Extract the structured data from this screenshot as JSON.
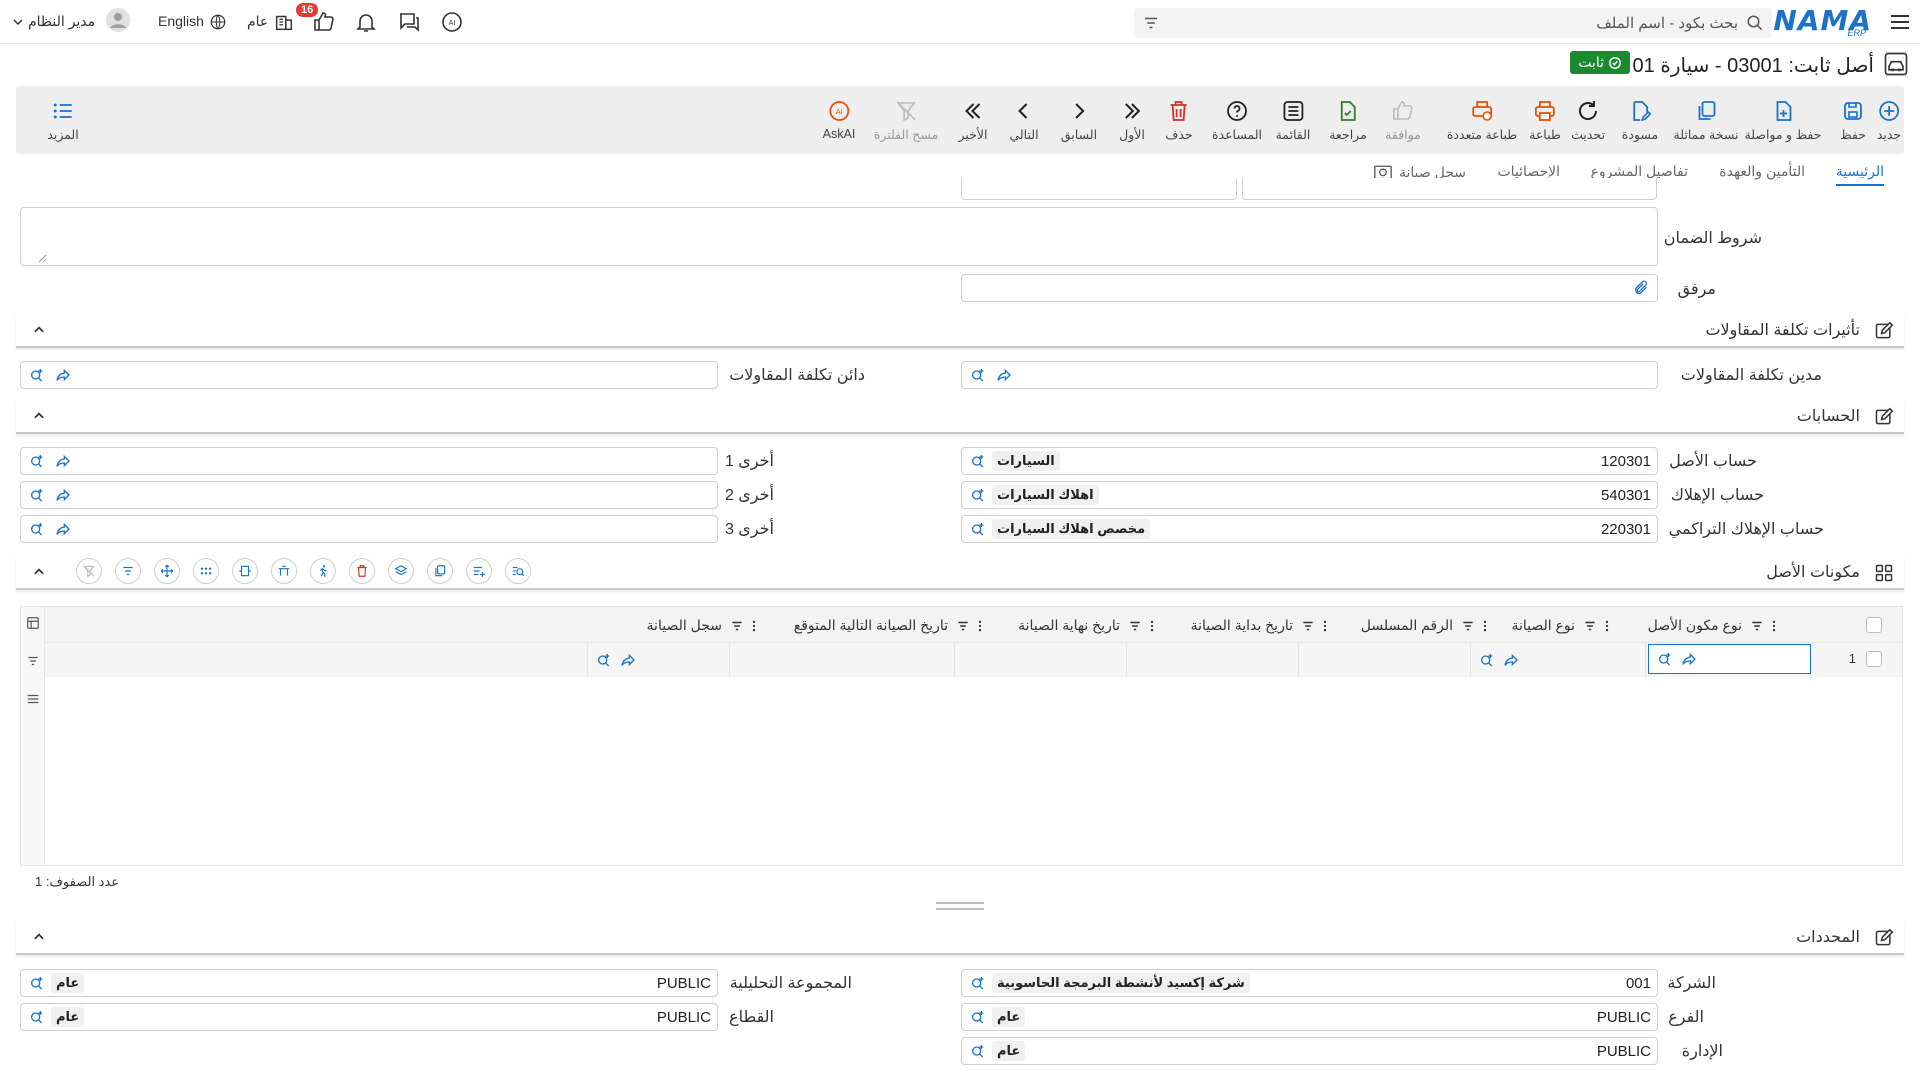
{
  "topbar": {
    "logo_text": "NAMA",
    "logo_sub": "ERP",
    "search_placeholder": "بحث بكود - اسم الملف",
    "notification_count": "16",
    "company": "عام",
    "language": "English",
    "user": "مدير النظام"
  },
  "title": {
    "text": "أصل ثابت: 03001 - سيارة 01",
    "status": "ثابت"
  },
  "toolbar": {
    "new": "جديد",
    "save": "حفظ",
    "save_continue": "حفظ و مواصلة",
    "duplicate": "نسخة مماثلة",
    "draft": "مسودة",
    "refresh": "تحديث",
    "print": "طباعة",
    "multi_print": "طباعة متعددة",
    "approve": "موافقة",
    "review": "مراجعة",
    "list": "القائمة",
    "help": "المساعدة",
    "delete": "حذف",
    "first": "الأول",
    "previous": "السابق",
    "next": "التالي",
    "last": "الأخير",
    "clear_filter": "مسح الفلترة",
    "askai": "AskAI",
    "more": "المزيد"
  },
  "tabs": [
    "الرئيسية",
    "التأمين والعهدة",
    "تفاصيل المشروع",
    "الإحصائيات",
    "سجل صيانة"
  ],
  "form": {
    "warranty_terms": "شروط الضمان",
    "attachment": "مرفق",
    "contract_section": "تأثيرات تكلفة المقاولات",
    "contract_debit": "مدين تكلفة المقاولات",
    "contract_credit": "دائن تكلفة المقاولات",
    "accounts_section": "الحسابات",
    "asset_account": "حساب الأصل",
    "asset_account_code": "120301",
    "asset_account_name": "السيارات",
    "depr_account": "حساب الإهلاك",
    "depr_account_code": "540301",
    "depr_account_name": "اهلاك السيارات",
    "accum_depr_account": "حساب الإهلاك التراكمي",
    "accum_depr_account_code": "220301",
    "accum_depr_account_name": "مخصص اهلاك السيارات",
    "other1": "أخرى 1",
    "other2": "أخرى 2",
    "other3": "أخرى 3",
    "components_section": "مكونات الأصل",
    "dimensions_section": "المحددات",
    "company": "الشركة",
    "company_code": "001",
    "company_name": "شركة إكسيد لأنشطة البرمجة الحاسوبية",
    "branch": "الفرع",
    "branch_code": "PUBLIC",
    "branch_name": "عام",
    "department": "الإدارة",
    "department_code": "PUBLIC",
    "department_name": "عام",
    "analytic_group": "المجموعة التحليلية",
    "analytic_group_code": "PUBLIC",
    "analytic_group_name": "عام",
    "sector": "القطاع",
    "sector_code": "PUBLIC",
    "sector_name": "عام"
  },
  "grid": {
    "columns": [
      "نوع مكون الأصل",
      "نوع الصيانة",
      "الرقم المسلسل",
      "تاريخ بداية الصيانة",
      "تاريخ نهاية الصيانة",
      "تاريخ الصيانة التالية المتوقع",
      "سجل الصيانة"
    ],
    "row_number": "1",
    "row_count": "عدد الصفوف: 1"
  }
}
